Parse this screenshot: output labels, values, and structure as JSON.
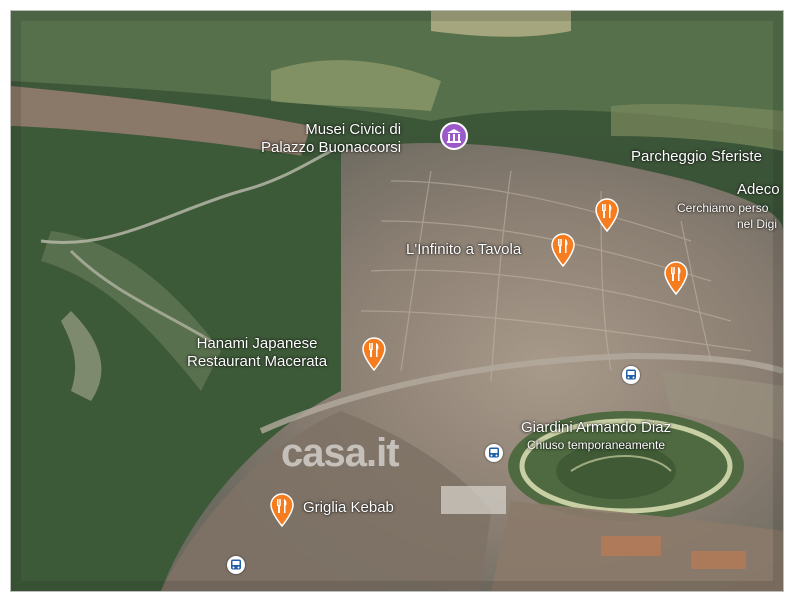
{
  "places": {
    "museum": {
      "line1": "Musei Civici di",
      "line2": "Palazzo Buonaccorsi"
    },
    "parking": "Parcheggio Sferiste",
    "adecco": {
      "title": "Adeco",
      "sub1": "Cerchiamo perso",
      "sub2": "nel Digi"
    },
    "infinito": "L'Infinito a Tavola",
    "hanami": {
      "line1": "Hanami Japanese",
      "line2": "Restaurant Macerata"
    },
    "giardini": {
      "title": "Giardini Armando Diaz",
      "sub": "Chiuso temporaneamente"
    },
    "griglia": "Griglia Kebab"
  },
  "watermark": "casa.it",
  "colors": {
    "restaurant_pin": "#f57c1f",
    "museum_pin": "#9b59c9",
    "label_text": "#ffffff"
  },
  "icons": {
    "restaurant": "fork-knife-icon",
    "museum": "museum-icon",
    "bus": "bus-icon"
  }
}
